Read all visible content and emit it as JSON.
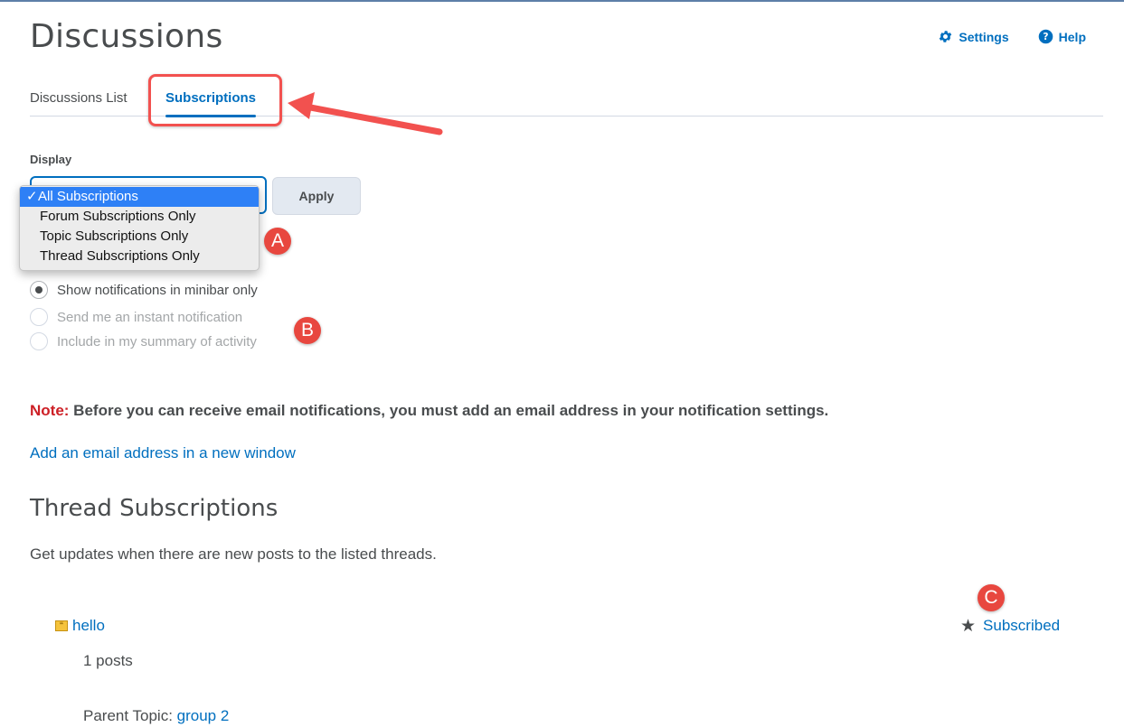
{
  "header": {
    "title": "Discussions",
    "settings_label": "Settings",
    "help_label": "Help"
  },
  "tabs": [
    {
      "label": "Discussions List",
      "active": false
    },
    {
      "label": "Subscriptions",
      "active": true
    }
  ],
  "display": {
    "label": "Display",
    "options": [
      "All Subscriptions",
      "Forum Subscriptions Only",
      "Topic Subscriptions Only",
      "Thread Subscriptions Only"
    ],
    "selected": "All Subscriptions",
    "checkmark": "✓",
    "apply_label": "Apply"
  },
  "notifications": [
    {
      "label": "Show notifications in minibar only",
      "checked": true,
      "enabled": true
    },
    {
      "label": "Send me an instant notification",
      "checked": false,
      "enabled": false
    },
    {
      "label": "Include in my summary of activity",
      "checked": false,
      "enabled": false
    }
  ],
  "note": {
    "label": "Note:",
    "text": " Before you can receive email notifications, you must add an email address in your notification settings."
  },
  "email_link": "Add an email address in a new window",
  "thread_section": {
    "title": "Thread Subscriptions",
    "description": "Get updates when there are new posts to the listed threads."
  },
  "threads": [
    {
      "title": "hello",
      "posts": "1 posts",
      "parent_label": "Parent Topic: ",
      "parent_topic": "group 2",
      "status": "Subscribed"
    }
  ],
  "annotations": {
    "a": "A",
    "b": "B",
    "c": "C"
  },
  "colors": {
    "accent": "#006fbf",
    "badge": "#e8473f",
    "note": "#cd2026",
    "highlight": "#f2514f"
  }
}
